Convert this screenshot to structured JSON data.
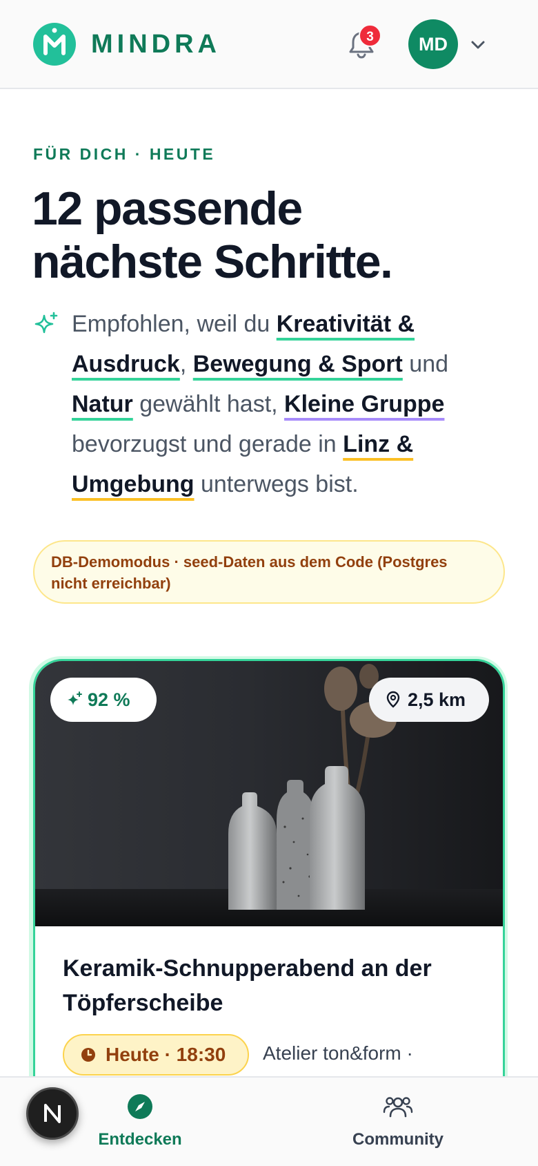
{
  "header": {
    "logo_text": "MINDRA",
    "notification_count": "3",
    "avatar_initials": "MD"
  },
  "intro": {
    "eyebrow": "FÜR DICH · HEUTE",
    "headline_line1": "12 passende",
    "headline_line2": "nächste Schritte.",
    "reason_parts": {
      "p1": "Empfohlen, weil du ",
      "kw1": "Kreativität & Ausdruck",
      "p2": ", ",
      "kw2": "Bewegung & Sport",
      "p3": " und ",
      "kw3": "Natur",
      "p4": " gewählt hast, ",
      "kw4": "Kleine Gruppe",
      "p5": " bevorzugst und gerade in ",
      "kw5": "Linz & Umgebung",
      "p6": " unterwegs bist."
    }
  },
  "notice": {
    "text": "DB-Demomodus · seed-Daten aus dem Code (Postgres nicht erreichbar)"
  },
  "card": {
    "match": "92 %",
    "distance": "2,5 km",
    "title": "Keramik-Schnupperabend an der Töpferscheibe",
    "time": "Heute · 18:30",
    "venue": "Atelier ton&form  ·"
  },
  "bottom_nav": {
    "items": [
      {
        "label": "Entdecken",
        "icon": "compass-icon",
        "active": true
      },
      {
        "label": "Community",
        "icon": "users-icon",
        "active": false
      }
    ]
  },
  "colors": {
    "brand": "#0f7a58",
    "brand_light": "#22c09a",
    "underline_green": "#34d399",
    "underline_purple": "#a78bfa",
    "underline_amber": "#fbbf24",
    "notice_text": "#92400e",
    "badge_red": "#ef2b3a"
  }
}
